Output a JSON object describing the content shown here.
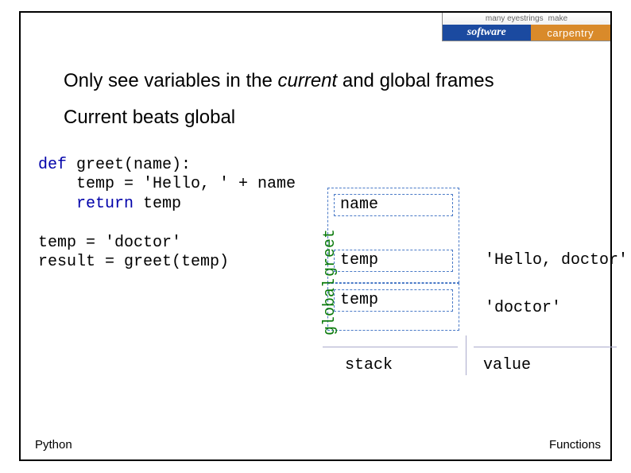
{
  "logo": {
    "tagline_left": "many eyestrings",
    "tagline_right": "make",
    "word1": "software",
    "word2": "carpentry"
  },
  "heading1_a": "Only see variables in the ",
  "heading1_b": "current",
  "heading1_c": " and global frames",
  "heading2": "Current beats global",
  "code": {
    "l1a": "def",
    "l1b": " greet(name):",
    "l2": "    temp = 'Hello, ' + name",
    "l3a": "    ",
    "l3b": "return",
    "l3c": " temp",
    "l4": "",
    "l5": "temp = 'doctor'",
    "l6": "result = greet(temp)"
  },
  "diagram": {
    "scope_inner": "greet",
    "scope_outer": "global",
    "vars": {
      "name": "name",
      "temp1": "temp",
      "temp2": "temp"
    },
    "values": {
      "v1": "'Hello, doctor'",
      "v2": "'doctor'"
    },
    "axis_stack": "stack",
    "axis_value": "value"
  },
  "footer": {
    "left": "Python",
    "right": "Functions"
  }
}
